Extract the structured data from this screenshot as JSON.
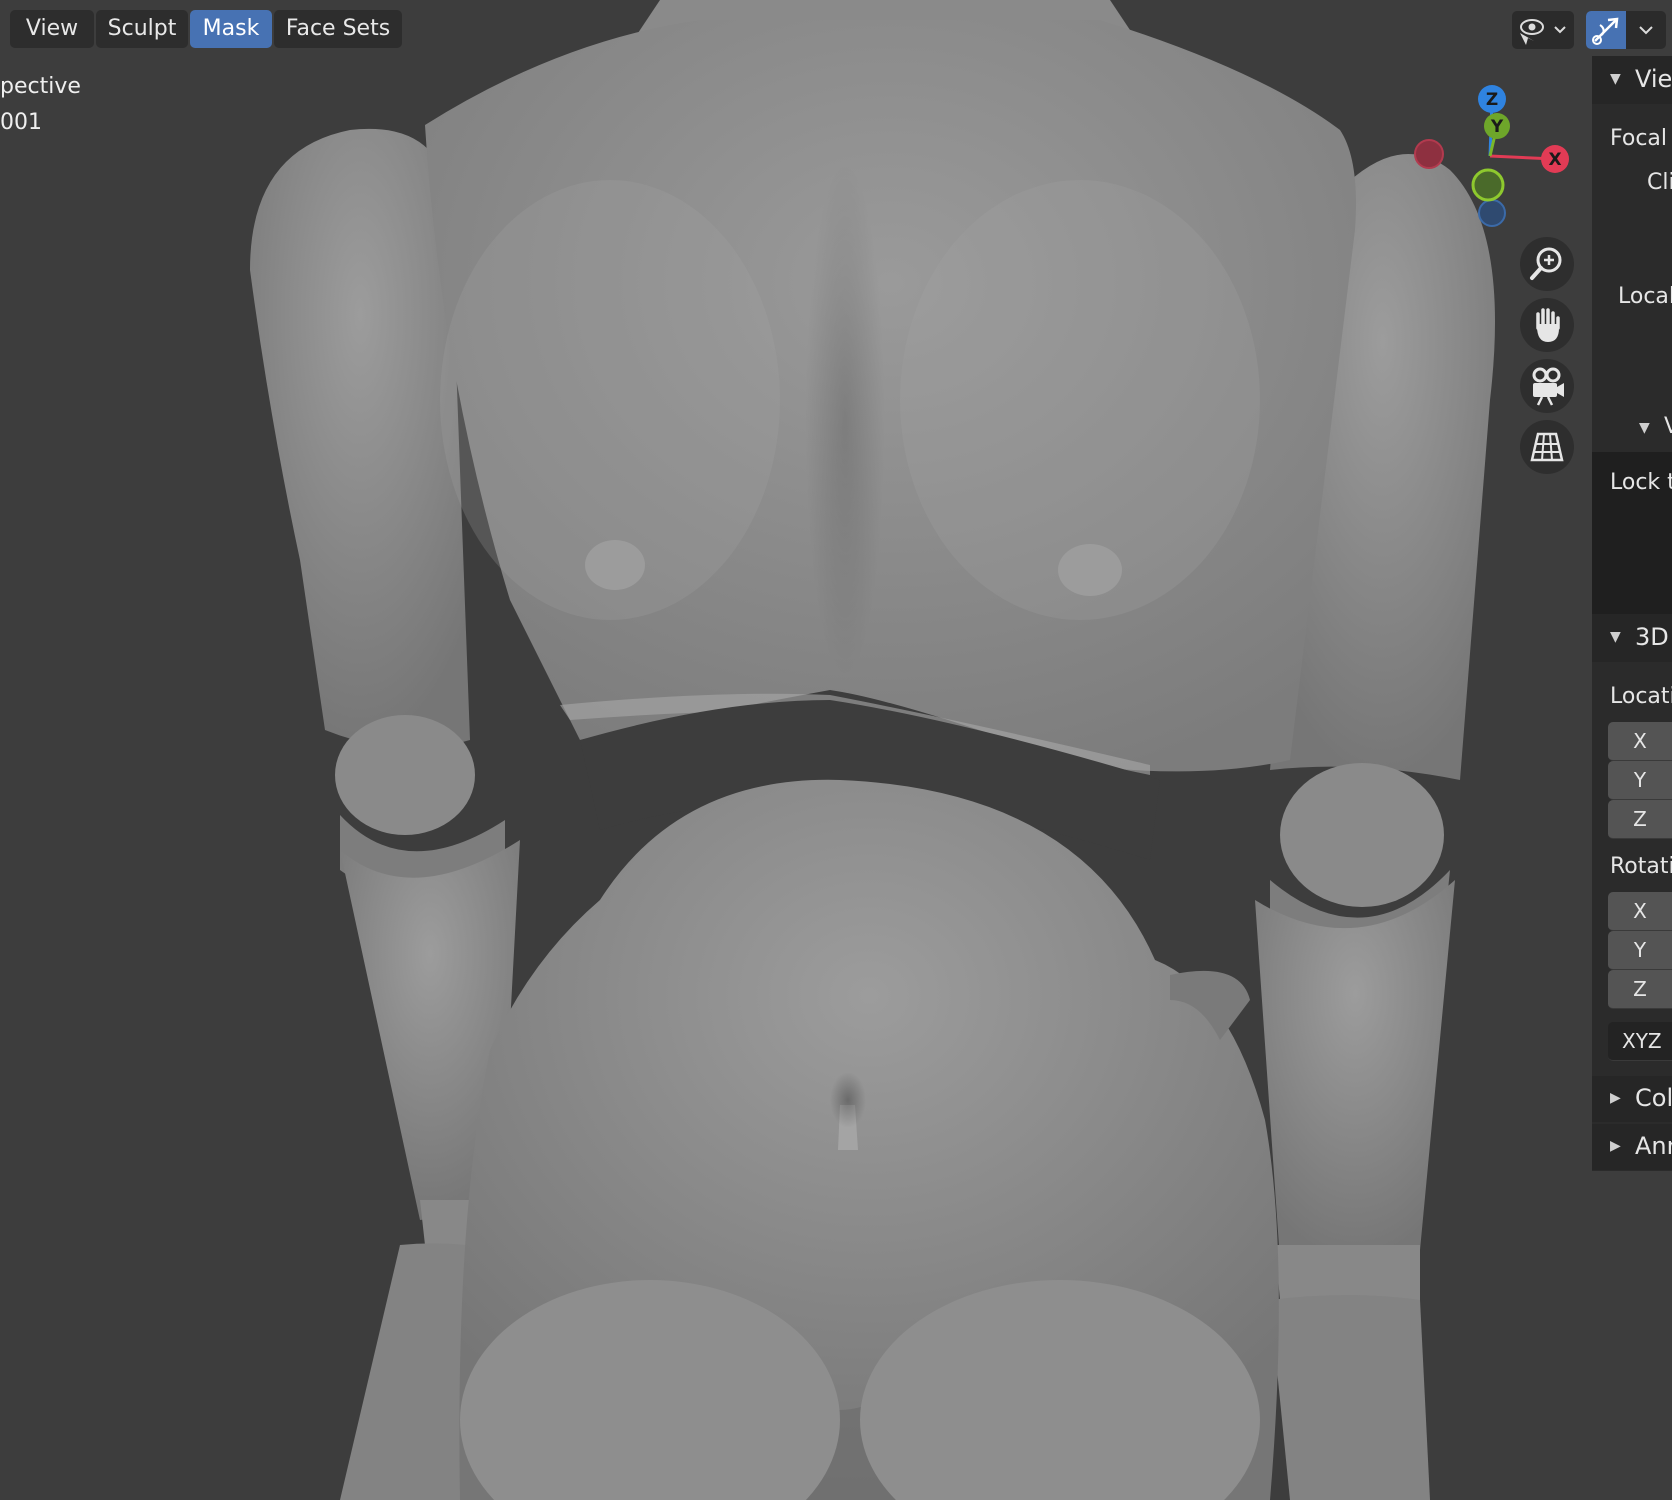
{
  "header": {
    "menus": [
      {
        "label": "View",
        "active": false
      },
      {
        "label": "Sculpt",
        "active": false
      },
      {
        "label": "Mask",
        "active": true
      },
      {
        "label": "Face Sets",
        "active": false
      }
    ],
    "accent_color": "#4772b3"
  },
  "viewport_overlay": {
    "view_name": "pective",
    "object_name": "001"
  },
  "gizmo": {
    "axes": {
      "x": "X",
      "y": "Y",
      "z": "Z"
    },
    "colors": {
      "x": "#e23b55",
      "y": "#7ab72a",
      "z": "#2f83e0"
    }
  },
  "nav_buttons": [
    "zoom-icon",
    "pan-hand-icon",
    "camera-icon",
    "grid-perspective-icon"
  ],
  "npanel": {
    "view_header": "Vie",
    "focal": "Focal",
    "clip": "Cli",
    "local": "Local",
    "sub_header": "V",
    "lock": "Lock t",
    "cursor_header": "3D",
    "location_label": "Locati",
    "location_axes": [
      "X",
      "Y",
      "Z"
    ],
    "rotation_label": "Rotati",
    "rotation_axes": [
      "X",
      "Y",
      "Z"
    ],
    "rotation_mode": "XYZ",
    "collections_header": "Col",
    "annotations_header": "Ann"
  }
}
